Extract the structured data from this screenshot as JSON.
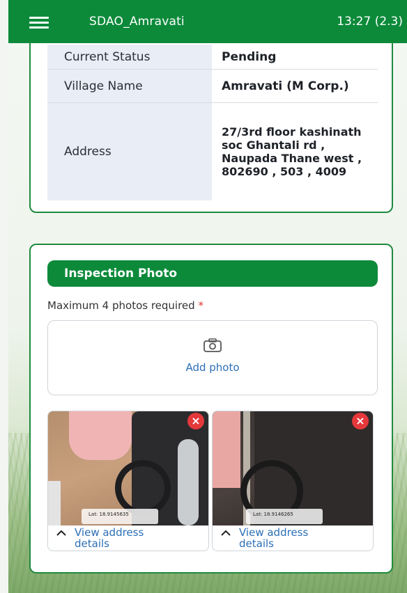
{
  "header": {
    "title": "SDAO_Amravati",
    "time": "13:27 (2.3)"
  },
  "details": {
    "rows": [
      {
        "label": "Current Status",
        "value": "Pending"
      },
      {
        "label": "Village Name",
        "value": "Amravati (M Corp.)"
      },
      {
        "label": "Address",
        "value": "27/3rd floor kashinath soc Ghantali rd , Naupada Thane west , 802690 , 503 , 4009"
      }
    ]
  },
  "inspection": {
    "section_title": "Inspection Photo",
    "requirement_note": "Maximum 4 photos required",
    "required_marker": "*",
    "add_photo_label": "Add photo",
    "photos": [
      {
        "geo_text": "Lat: 18.9145635",
        "remove_label": "×",
        "link_label": "View address details"
      },
      {
        "geo_text": "Lat: 18.9146265",
        "remove_label": "×",
        "link_label": "View address details"
      }
    ]
  },
  "colors": {
    "primary": "#0c8a3a",
    "status_pending": "#c8a81a",
    "link": "#2c6fb6",
    "remove": "#e5383b"
  }
}
